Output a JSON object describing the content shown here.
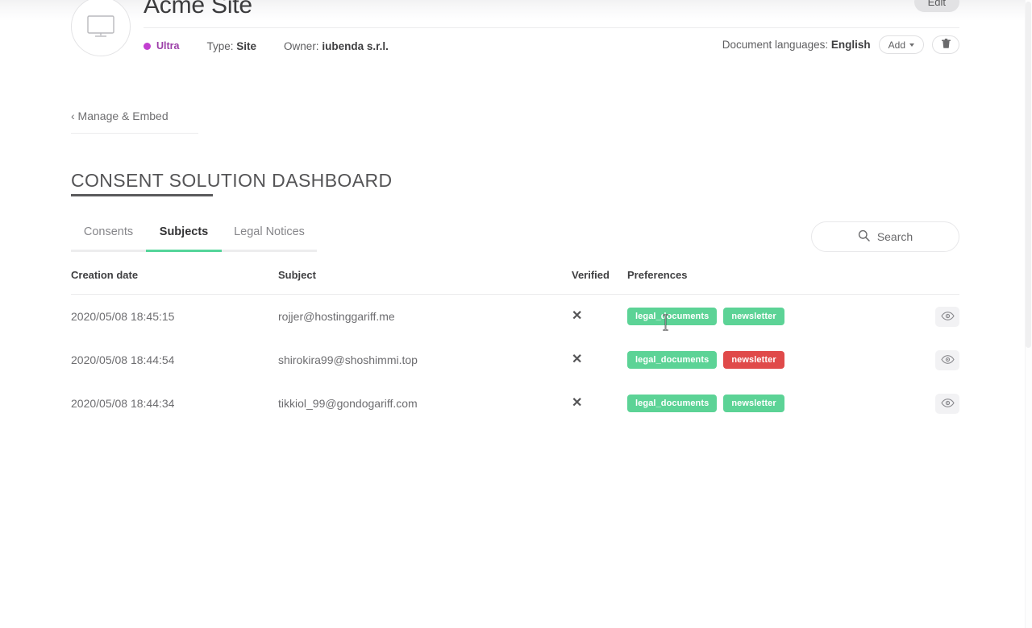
{
  "header": {
    "site_icon": "monitor-icon",
    "title": "Acme Site",
    "plan_badge": "Ultra",
    "plan_color": "#c23fd0",
    "type_label": "Type:",
    "type_value": "Site",
    "owner_label": "Owner:",
    "owner_value": "iubenda s.r.l.",
    "doc_languages_label": "Document languages:",
    "doc_languages_value": "English",
    "add_label": "Add",
    "delete_icon": "trash-icon",
    "edit_label": "Edit"
  },
  "breadcrumb": {
    "back_label": "‹ Manage & Embed"
  },
  "page": {
    "title": "CONSENT SOLUTION DASHBOARD"
  },
  "tabs": [
    {
      "label": "Consents",
      "active": false
    },
    {
      "label": "Subjects",
      "active": true
    },
    {
      "label": "Legal Notices",
      "active": false
    }
  ],
  "search": {
    "label": "Search",
    "icon": "search-icon"
  },
  "table": {
    "columns": [
      "Creation date",
      "Subject",
      "Verified",
      "Preferences",
      ""
    ],
    "rows": [
      {
        "creation_date": "2020/05/08 18:45:15",
        "subject": "rojjer@hostinggariff.me",
        "verified": "✕",
        "preferences": [
          {
            "label": "legal_documents",
            "state": "green"
          },
          {
            "label": "newsletter",
            "state": "green"
          }
        ],
        "action_icon": "eye-icon"
      },
      {
        "creation_date": "2020/05/08 18:44:54",
        "subject": "shirokira99@shoshimmi.top",
        "verified": "✕",
        "preferences": [
          {
            "label": "legal_documents",
            "state": "green"
          },
          {
            "label": "newsletter",
            "state": "red"
          }
        ],
        "action_icon": "eye-icon"
      },
      {
        "creation_date": "2020/05/08 18:44:34",
        "subject": "tikkiol_99@gondogariff.com",
        "verified": "✕",
        "preferences": [
          {
            "label": "legal_documents",
            "state": "green"
          },
          {
            "label": "newsletter",
            "state": "green"
          }
        ],
        "action_icon": "eye-icon"
      }
    ]
  },
  "colors": {
    "accent_green": "#5cd396",
    "danger_red": "#e04a4a",
    "plan_purple": "#c23fd0"
  }
}
